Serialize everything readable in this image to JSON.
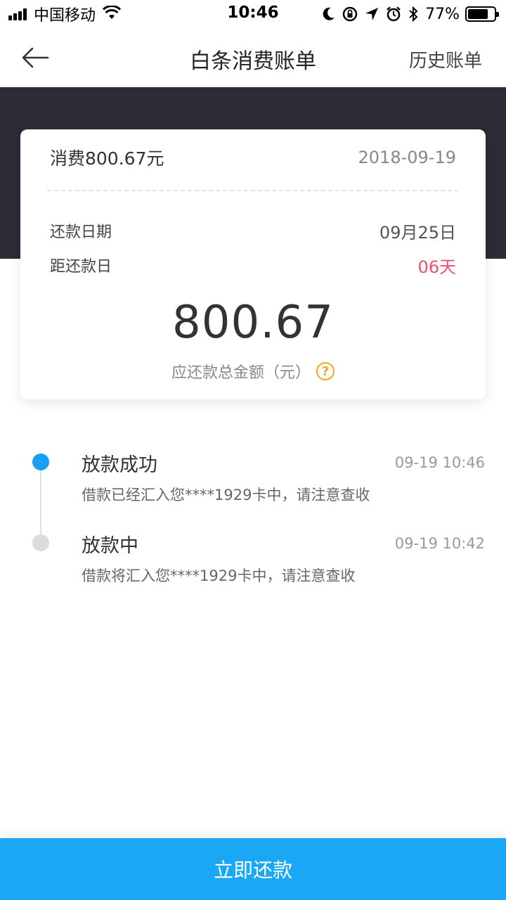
{
  "status_bar": {
    "carrier": "中国移动",
    "time": "10:46",
    "battery_percent": "77%",
    "battery_level": 0.77,
    "icons": [
      "signal-icon",
      "wifi-icon",
      "moon-icon",
      "rotation-lock-icon",
      "location-icon",
      "alarm-icon",
      "bluetooth-icon",
      "battery-icon"
    ]
  },
  "nav": {
    "title": "白条消费账单",
    "history_label": "历史账单",
    "back_icon": "arrow-left-icon"
  },
  "bill": {
    "consume_label": "消费800.67元",
    "bill_date": "2018-09-19",
    "repay_date_label": "还款日期",
    "repay_date_value": "09月25日",
    "days_left_label": "距还款日",
    "days_left_value": "06天",
    "total_amount": "800.67",
    "total_label": "应还款总金额（元）",
    "help_icon": "question-circle-icon",
    "help_symbol": "?"
  },
  "timeline": [
    {
      "title": "放款成功",
      "time": "09-19 10:46",
      "desc": "借款已经汇入您****1929卡中，请注意查收",
      "status": "active"
    },
    {
      "title": "放款中",
      "time": "09-19 10:42",
      "desc": "借款将汇入您****1929卡中，请注意查收",
      "status": "inactive"
    }
  ],
  "repay_button": {
    "label": "立即还款"
  },
  "colors": {
    "accent": "#1aa8f5",
    "dot_active": "#1a9ef5",
    "warning_red": "#f0506e",
    "help_orange": "#f5a623",
    "dark_band": "#2c2c36"
  }
}
